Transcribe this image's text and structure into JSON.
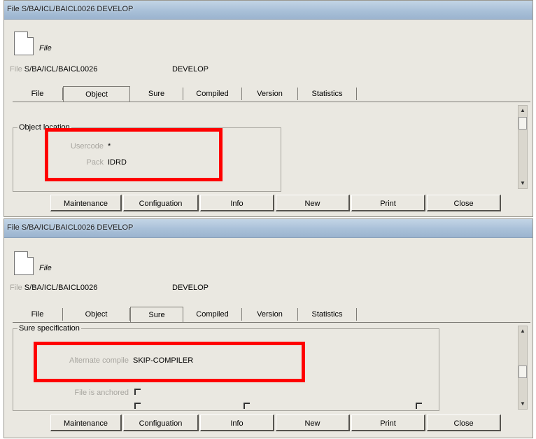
{
  "windows": [
    {
      "title": "File S/BA/ICL/BAICL0026 DEVELOP",
      "file_label": "File",
      "path_prefix": "File",
      "path": "S/BA/ICL/BAICL0026",
      "status": "DEVELOP",
      "tabs": [
        "File",
        "Object",
        "Sure",
        "Compiled",
        "Version",
        "Statistics"
      ],
      "active_tab": "Object",
      "group_title": "Object location",
      "fields": [
        {
          "label": "Usercode",
          "value": "*"
        },
        {
          "label": "Pack",
          "value": "IDRD"
        }
      ],
      "buttons": [
        "Maintenance",
        "Configuation",
        "Info",
        "New",
        "Print",
        "Close"
      ]
    },
    {
      "title": "File S/BA/ICL/BAICL0026 DEVELOP",
      "file_label": "File",
      "path_prefix": "File",
      "path": "S/BA/ICL/BAICL0026",
      "status": "DEVELOP",
      "tabs": [
        "File",
        "Object",
        "Sure",
        "Compiled",
        "Version",
        "Statistics"
      ],
      "active_tab": "Sure",
      "group_title": "Sure specification",
      "fields": [
        {
          "label": "Alternate compile",
          "value": "SKIP-COMPILER"
        },
        {
          "label": "File is anchored",
          "value": ""
        }
      ],
      "buttons": [
        "Maintenance",
        "Configuation",
        "Info",
        "New",
        "Print",
        "Close"
      ]
    }
  ],
  "colors": {
    "highlight": "#ff0000",
    "window_bg": "#eae8e1",
    "titlebar": "#a9c0d8"
  }
}
